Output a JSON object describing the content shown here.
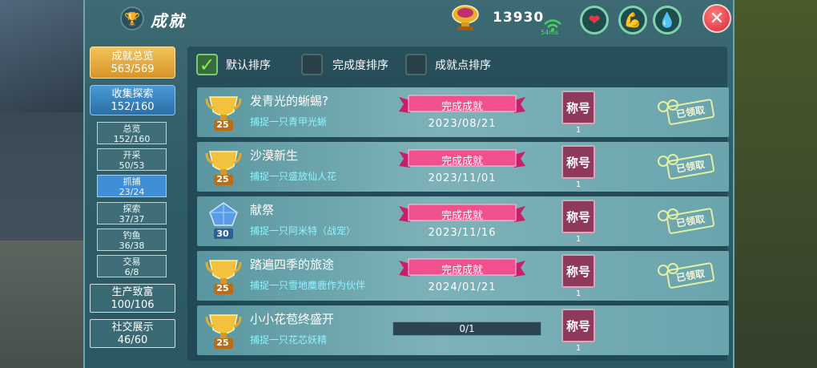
{
  "header": {
    "title": "成就",
    "points": "13930",
    "ping": "54ms"
  },
  "icons": {
    "heart": "heart-icon",
    "stamina": "arm-icon",
    "water": "water-drop-icon"
  },
  "sidebar": {
    "overview": {
      "label": "成就总览",
      "value": "563/569"
    },
    "collect": {
      "label": "收集探索",
      "value": "152/160"
    },
    "sub_items": [
      {
        "label": "总览",
        "value": "152/160",
        "active": false
      },
      {
        "label": "开采",
        "value": "50/53",
        "active": false
      },
      {
        "label": "抓捕",
        "value": "23/24",
        "active": true
      },
      {
        "label": "探索",
        "value": "37/37",
        "active": false
      },
      {
        "label": "钓鱼",
        "value": "36/38",
        "active": false
      },
      {
        "label": "交易",
        "value": "6/8",
        "active": false
      }
    ],
    "production": {
      "label": "生产致富",
      "value": "100/106"
    },
    "social": {
      "label": "社交展示",
      "value": "46/60"
    }
  },
  "sort": {
    "default": "默认排序",
    "completion": "完成度排序",
    "points": "成就点排序"
  },
  "achievements": [
    {
      "name": "发青光的蜥蜴?",
      "desc": "捕捉一只青甲光蜥",
      "level": "25",
      "status": "完成成就",
      "date": "2023/08/21",
      "reward": "称号",
      "reward_count": "1",
      "claimed": "已领取",
      "cup": "gold"
    },
    {
      "name": "沙漠新生",
      "desc": "捕捉一只盛放仙人花",
      "level": "25",
      "status": "完成成就",
      "date": "2023/11/01",
      "reward": "称号",
      "reward_count": "1",
      "claimed": "已领取",
      "cup": "gold"
    },
    {
      "name": "献祭",
      "desc": "捕捉一只阿米特（战宠）",
      "level": "30",
      "status": "完成成就",
      "date": "2023/11/16",
      "reward": "称号",
      "reward_count": "1",
      "claimed": "已领取",
      "cup": "crystal"
    },
    {
      "name": "踏遍四季的旅途",
      "desc": "捕捉一只雪地麋鹿作为伙伴",
      "level": "25",
      "status": "完成成就",
      "date": "2024/01/21",
      "reward": "称号",
      "reward_count": "1",
      "claimed": "已领取",
      "cup": "gold"
    },
    {
      "name": "小小花苞终盛开",
      "desc": "捕捉一只花芯妖精",
      "level": "25",
      "progress": "0/1",
      "progress_fraction": 0,
      "reward": "称号",
      "reward_count": "1",
      "cup": "gold"
    }
  ]
}
